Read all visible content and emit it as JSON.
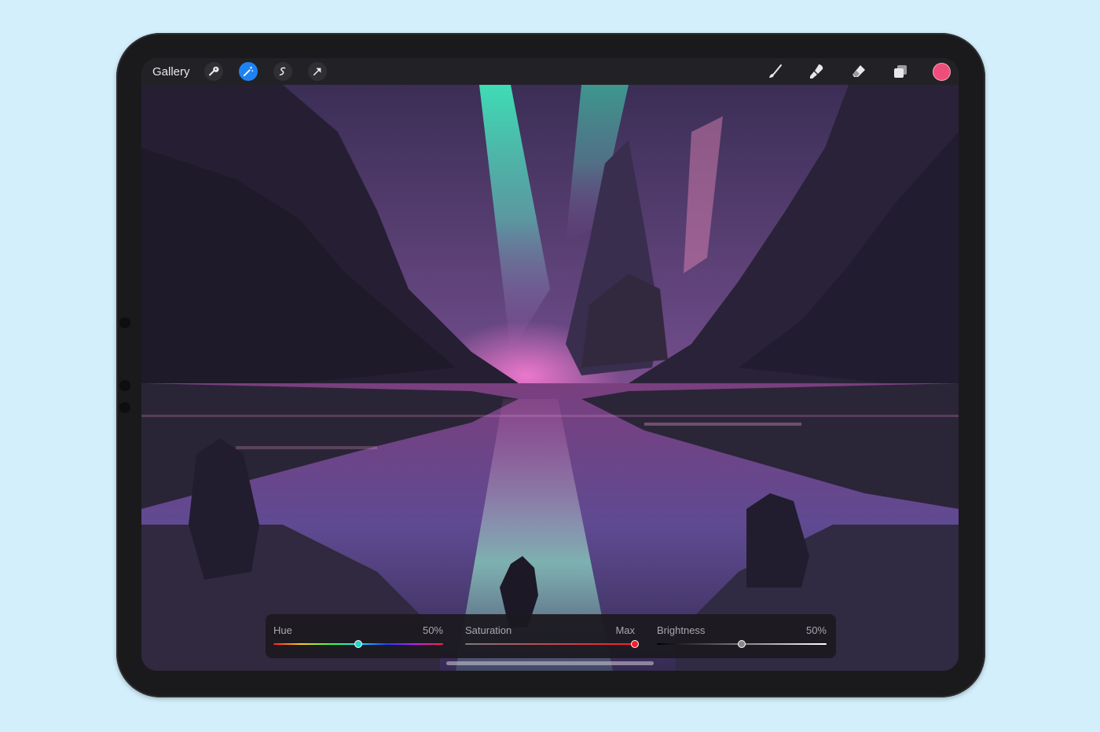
{
  "toolbar": {
    "gallery_label": "Gallery",
    "left_icons": [
      "wrench-icon",
      "magic-wand-icon",
      "selection-icon",
      "transform-arrow-icon"
    ],
    "right_icons": [
      "brush-icon",
      "smudge-icon",
      "eraser-icon",
      "layers-icon"
    ],
    "active_icon": "magic-wand-icon",
    "current_color": "#ee4f7a"
  },
  "adjustments": {
    "hue": {
      "label": "Hue",
      "value": "50%",
      "level": 0.5
    },
    "saturation": {
      "label": "Saturation",
      "value": "Max",
      "level": 1.0
    },
    "brightness": {
      "label": "Brightness",
      "value": "50%",
      "level": 0.5
    }
  },
  "colors": {
    "accent": "#1f82f2",
    "background": "#d3effb",
    "device": "#1a1a1c"
  }
}
